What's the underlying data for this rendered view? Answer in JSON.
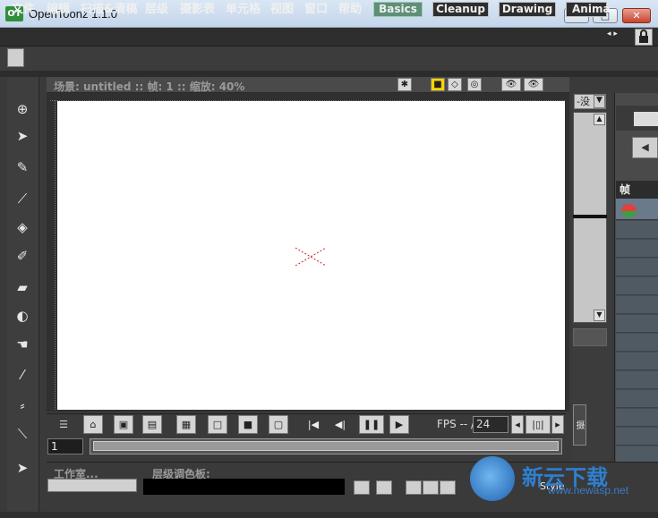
{
  "window": {
    "title": "OpenToonz 1.1.0",
    "logo": "OT",
    "minimize": "–",
    "maximize": "□",
    "close": "✕"
  },
  "menu": [
    "文件",
    "编辑",
    "扫描&清稿",
    "层级",
    "摄影表",
    "单元格",
    "视图",
    "窗口",
    "帮助"
  ],
  "rooms": [
    "Basics",
    "Cleanup",
    "Drawing",
    "Anima"
  ],
  "rooms_arrows": "◂ ▸",
  "viewer": {
    "info": "场景: untitled   ::   帧: 1   ::   缩放: 40%"
  },
  "playback": {
    "fps_label": "FPS -- /",
    "fps_value": "24",
    "frame_value": "1"
  },
  "right_panel": {
    "select_value": "-没",
    "vertical_tab": "摄"
  },
  "xsheet": {
    "header": "帧"
  },
  "bottom": {
    "room_label": "工作室...",
    "palette_label": "层级调色板:",
    "style_text": "Style"
  },
  "watermark": {
    "text": "新云下载",
    "url": "www.newasp.net"
  },
  "colors": {
    "accent_basics": "#5f8f79",
    "canvas": "#ffffff",
    "bg": "#3a3a3a"
  },
  "tools": [
    "animate-tool-icon",
    "selection-tool-icon",
    "brush-tool-icon",
    "geometric-tool-icon",
    "fill-tool-icon",
    "paint-brush-tool-icon",
    "eraser-tool-icon",
    "tape-tool-icon",
    "finger-tool-icon",
    "style-picker-icon",
    "rgb-picker-icon",
    "ruler-tool-icon",
    "selection-tool-2-icon"
  ]
}
